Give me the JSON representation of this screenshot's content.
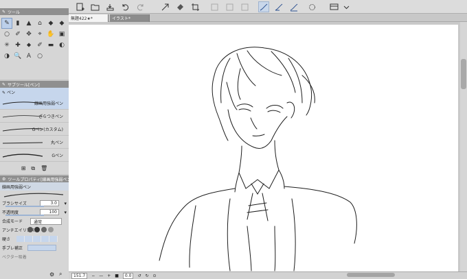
{
  "toolbar": {
    "icons": [
      "new-icon",
      "open-icon",
      "save-icon",
      "undo-icon",
      "redo-icon",
      "transform-icon",
      "fill-icon",
      "crop-icon",
      "disabled-icon-1",
      "disabled-icon-2",
      "disabled-icon-3",
      "stabilize-icon-1",
      "stabilize-icon-2",
      "stabilize-icon-3",
      "sun-icon",
      "canvas-icon",
      "chevron-down-icon"
    ]
  },
  "tabs": [
    {
      "label": "無題422★*"
    },
    {
      "label": "イラスト*"
    }
  ],
  "tool_panel": {
    "title": "ツール",
    "tools": [
      "✎",
      "▮",
      "▲",
      "⌂",
      "◆",
      "◆",
      "○",
      "✐",
      "✥",
      "⌖",
      "✋",
      "▣",
      "✳",
      "✚",
      "⬥",
      "✐",
      "▬",
      "◐",
      "◑",
      "🔍",
      "A",
      "○"
    ]
  },
  "subtool_panel": {
    "title": "サブツール[ペン]",
    "group_label": "ペン",
    "items": [
      {
        "label": "線画用強弱ペン",
        "selected": true
      },
      {
        "label": "ざらつきペン"
      },
      {
        "label": "Gペン(カスタム)"
      },
      {
        "label": "丸ペン"
      },
      {
        "label": "Gペン"
      },
      {
        "label": "効果線用"
      },
      {
        "label": "カブラペン"
      }
    ]
  },
  "property_panel": {
    "title": "ツールプロパティ[線画用強弱ペン]",
    "preset_label": "線画用強弱ペン",
    "brush_size_label": "ブラシサイズ",
    "brush_size": "3.0",
    "opacity_label": "不透明度",
    "opacity": "100",
    "blend_label": "合成モード",
    "blend_value": "通常",
    "antialias_label": "アンチエイリアス",
    "hardness_label": "硬さ",
    "stabilization_label": "手ブレ補正",
    "vector_label": "ベクター吸着"
  },
  "status": {
    "zoom": "151.7",
    "angle": "0.0"
  },
  "colors": {
    "panel_header": "#8f8f8f",
    "selection": "#c6d6ec",
    "paper": "#ffffff"
  }
}
